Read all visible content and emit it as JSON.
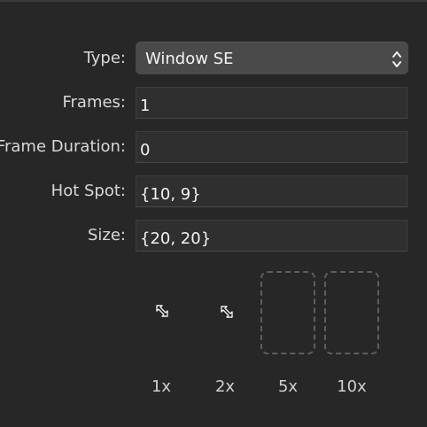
{
  "form": {
    "type": {
      "label": "Type:",
      "value": "Window SE"
    },
    "frames": {
      "label": "Frames:",
      "value": "1"
    },
    "frame_duration": {
      "label": "Frame Duration:",
      "value": "0"
    },
    "hot_spot": {
      "label": "Hot Spot:",
      "value": "{10, 9}"
    },
    "size": {
      "label": "Size:",
      "value": "{20, 20}"
    }
  },
  "previews": [
    {
      "scale": "1x",
      "state": "filled",
      "icon": "resize-se-cursor-icon"
    },
    {
      "scale": "2x",
      "state": "filled",
      "icon": "resize-se-cursor-icon"
    },
    {
      "scale": "5x",
      "state": "empty"
    },
    {
      "scale": "10x",
      "state": "empty"
    }
  ],
  "colors": {
    "background": "#272727",
    "field": "#2f2f2f",
    "select": "#4a4a4a",
    "text": "#f2f2f2",
    "dashed_border": "#5e5e5e"
  }
}
